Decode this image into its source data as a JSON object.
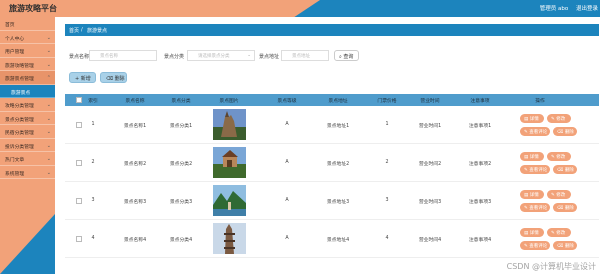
{
  "app": {
    "title": "旅游攻略平台",
    "user_greeting": "管理员 abo",
    "logout_label": "退出登录"
  },
  "sidebar": {
    "items": [
      {
        "label": "首页",
        "has_children": false
      },
      {
        "label": "个人中心",
        "has_children": true
      },
      {
        "label": "用户管理",
        "has_children": true
      },
      {
        "label": "旅游攻略管理",
        "has_children": true
      },
      {
        "label": "旅游景点管理",
        "has_children": true,
        "open": true
      },
      {
        "label": "旅游景点",
        "sub": true
      },
      {
        "label": "攻略分类管理",
        "has_children": true
      },
      {
        "label": "景点分类管理",
        "has_children": true
      },
      {
        "label": "民宿分类管理",
        "has_children": true
      },
      {
        "label": "投诉分类管理",
        "has_children": true
      },
      {
        "label": "热门文章",
        "has_children": true
      },
      {
        "label": "系统管理",
        "has_children": true
      }
    ]
  },
  "breadcrumb": {
    "home": "首页",
    "current": "旅游景点"
  },
  "filters": {
    "name_label": "景点名称",
    "name_placeholder": "景点名称",
    "category_label": "景点分类",
    "category_placeholder": "请选择景点分类",
    "address_label": "景点地址",
    "address_placeholder": "景点地址",
    "search_label": "查询"
  },
  "actions": {
    "add_label": "新增",
    "delete_label": "删除"
  },
  "table": {
    "headers": [
      "索引",
      "景点名称",
      "景点分类",
      "景点图片",
      "景点等级",
      "景点地址",
      "门票价格",
      "营业时间",
      "注意事项",
      "操作"
    ],
    "rows": [
      {
        "index": "1",
        "name": "景点名称1",
        "category": "景点分类1",
        "level": "A",
        "address": "景点地址1",
        "price": "1",
        "hours": "营业时间1",
        "notes": "注意事项1"
      },
      {
        "index": "2",
        "name": "景点名称2",
        "category": "景点分类2",
        "level": "A",
        "address": "景点地址2",
        "price": "2",
        "hours": "营业时间2",
        "notes": "注意事项2"
      },
      {
        "index": "3",
        "name": "景点名称3",
        "category": "景点分类3",
        "level": "A",
        "address": "景点地址3",
        "price": "3",
        "hours": "营业时间3",
        "notes": "注意事项3"
      },
      {
        "index": "4",
        "name": "景点名称4",
        "category": "景点分类4",
        "level": "A",
        "address": "景点地址4",
        "price": "4",
        "hours": "营业时间4",
        "notes": "注意事项4"
      }
    ],
    "row_actions": {
      "detail": "详情",
      "edit": "修改",
      "comments": "查看评论",
      "delete": "删除"
    }
  },
  "watermark": "CSDN @计算机毕业设计",
  "colors": {
    "primary": "#1c84bd",
    "accent": "#f2a279",
    "header": "#4f9ccc",
    "button": "#a9d1e8"
  },
  "icons": {
    "search": "search-icon",
    "add": "plus-icon",
    "delete": "trash-icon",
    "detail": "doc-icon",
    "edit": "pencil-icon",
    "chevron": "chevron-down-icon"
  }
}
